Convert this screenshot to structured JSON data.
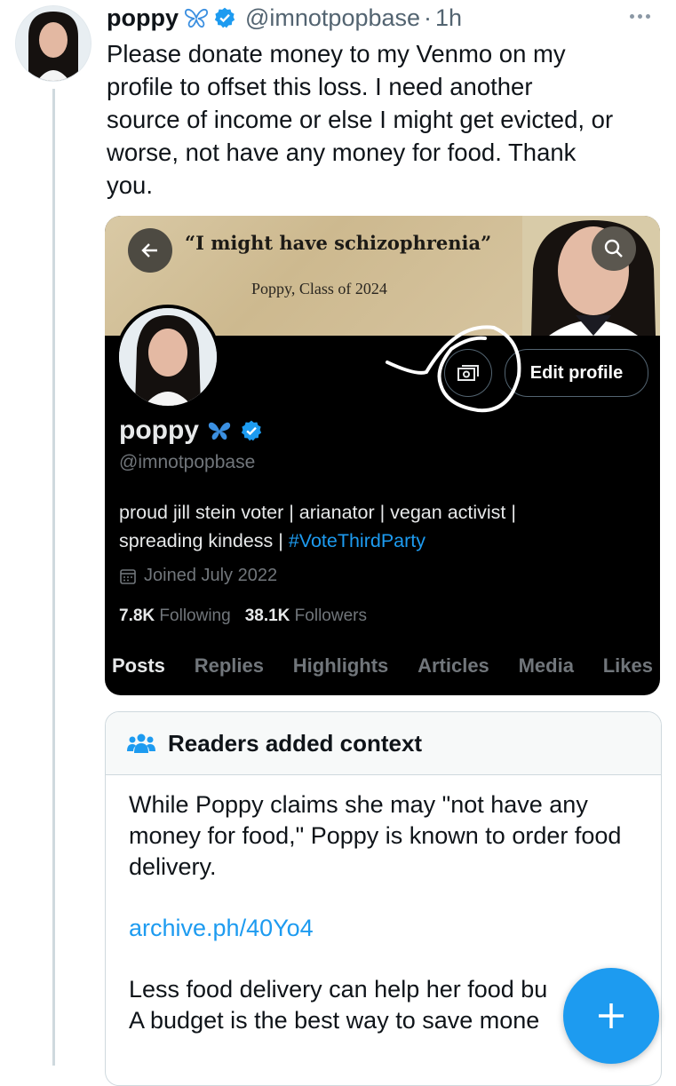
{
  "tweet": {
    "author_name": "poppy",
    "handle": "@imnotpopbase",
    "separator": "·",
    "time": "1h",
    "text": "Please donate money to my Venmo on my\nprofile to offset this loss. I need another\nsource of income or else I might get evicted, or\nworse, not have any money for food. Thank\nyou."
  },
  "screenshot": {
    "banner_quote": "“I might have schizophrenia”",
    "banner_caption": "Poppy, Class of 2024",
    "edit_profile_label": "Edit profile",
    "name": "poppy",
    "handle": "@imnotpopbase",
    "bio_plain": "proud jill stein voter | arianator | vegan activist |\nspreading kindess | ",
    "bio_hashtag": "#VoteThirdParty",
    "joined": "Joined July 2022",
    "following_count": "7.8K",
    "following_label": "Following",
    "followers_count": "38.1K",
    "followers_label": "Followers",
    "tabs": [
      "Posts",
      "Replies",
      "Highlights",
      "Articles",
      "Media",
      "Likes"
    ]
  },
  "note": {
    "title": "Readers added context",
    "paragraph1": "While Poppy claims she may \"not have any money for food,\" Poppy is known to order food delivery.",
    "link": "archive.ph/40Yo4",
    "paragraph2": "Less food delivery can help her food bu\nA budget is the best way to save mone"
  },
  "colors": {
    "accent": "#1d9bf0",
    "verified": "#1d9bf0",
    "butterfly": "#3b8fe0"
  },
  "icons": [
    "butterfly-icon",
    "verified-badge-icon",
    "more-icon",
    "back-arrow-icon",
    "search-icon",
    "money-icon",
    "calendar-icon",
    "people-icon",
    "plus-icon"
  ]
}
